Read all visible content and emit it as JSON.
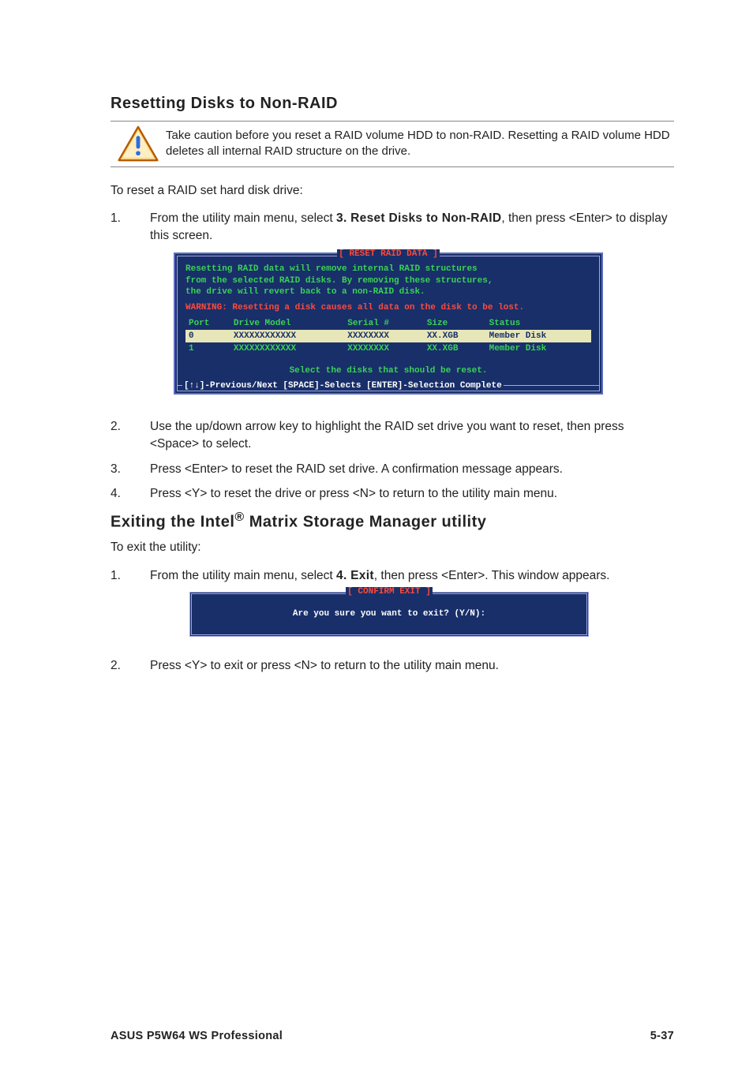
{
  "section1": {
    "heading": "Resetting Disks to Non-RAID",
    "caution": "Take caution before you reset a RAID volume HDD to non-RAID. Resetting a RAID volume HDD deletes all internal RAID structure on the drive.",
    "intro": "To reset a RAID set hard disk drive:",
    "step1_pre": "From the utility main menu, select ",
    "step1_bold": "3. Reset Disks to Non-RAID",
    "step1_post": ", then press <Enter> to display this screen.",
    "step2": "Use the up/down arrow key to highlight the RAID set drive you want to reset, then press <Space> to select.",
    "step3": "Press <Enter> to reset the RAID set drive. A confirmation message appears.",
    "step4": "Press <Y> to reset the drive or press <N> to return to the utility main menu."
  },
  "bios_reset": {
    "title": "[ RESET RAID DATA ]",
    "msg1": "Resetting RAID data will remove internal RAID structures",
    "msg2": "from the selected RAID disks. By removing these structures,",
    "msg3": "the drive will revert back to a non-RAID disk.",
    "warning": "WARNING: Resetting a disk causes all data on the disk to be lost.",
    "col_port": "Port",
    "col_model": "Drive Model",
    "col_serial": "Serial #",
    "col_size": "Size",
    "col_status": "Status",
    "rows": [
      {
        "port": "0",
        "model": "XXXXXXXXXXXX",
        "serial": "XXXXXXXX",
        "size": "XX.XGB",
        "status": "Member Disk",
        "selected": true
      },
      {
        "port": "1",
        "model": "XXXXXXXXXXXX",
        "serial": "XXXXXXXX",
        "size": "XX.XGB",
        "status": "Member Disk",
        "selected": false
      }
    ],
    "select_hint": "Select the disks that should be reset.",
    "footer": "[↑↓]-Previous/Next  [SPACE]-Selects  [ENTER]-Selection Complete"
  },
  "section2": {
    "heading_pre": "Exiting the Intel",
    "heading_reg": "®",
    "heading_post": " Matrix Storage Manager utility",
    "intro": "To exit the utility:",
    "step1_pre": "From the utility main menu, select ",
    "step1_bold": "4. Exit",
    "step1_post": ", then press <Enter>. This window appears.",
    "step2": "Press <Y> to exit or press <N> to return to the utility main menu."
  },
  "confirm_exit": {
    "title": "[ CONFIRM EXIT ]",
    "body": "Are you sure you want to exit? (Y/N):"
  },
  "footer": {
    "left": "ASUS P5W64 WS Professional",
    "right": "5-37"
  },
  "nums": {
    "n1": "1.",
    "n2": "2.",
    "n3": "3.",
    "n4": "4."
  }
}
